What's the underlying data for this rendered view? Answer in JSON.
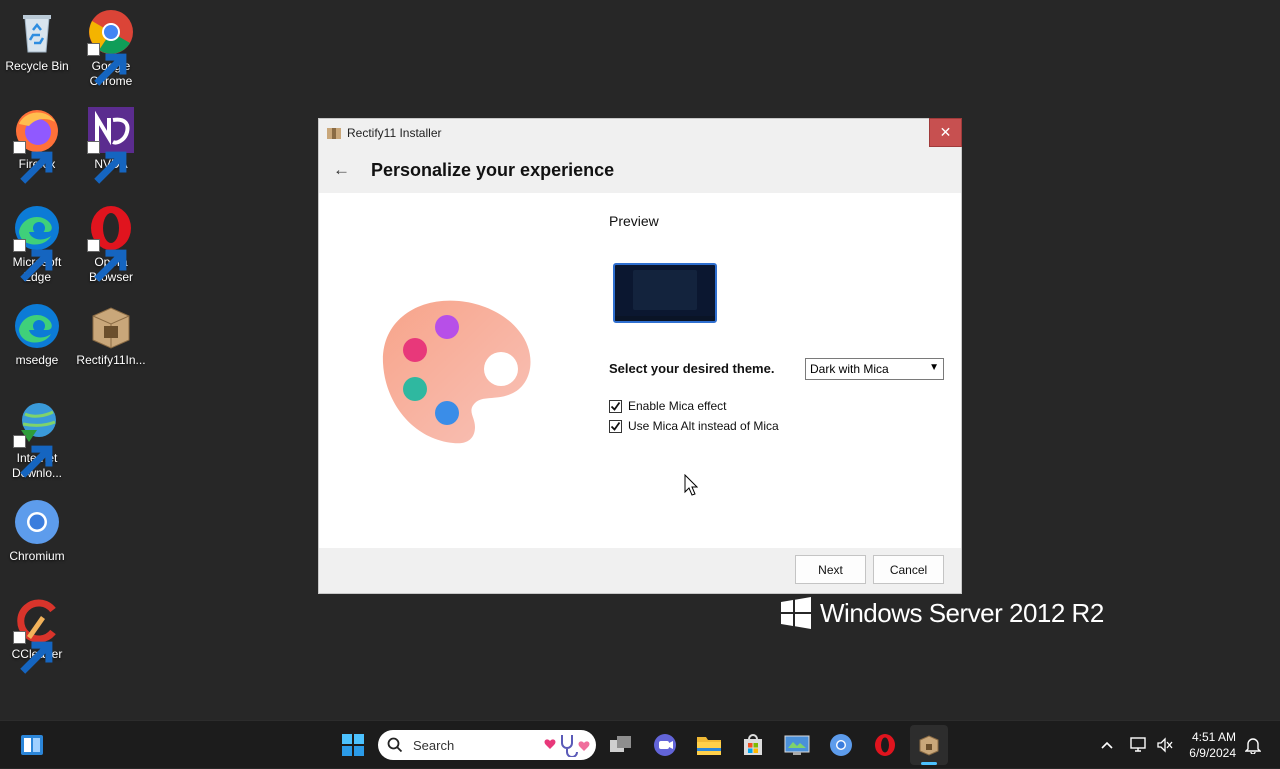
{
  "desktop": {
    "icons": [
      {
        "label": "Recycle Bin"
      },
      {
        "label": "Google Chrome"
      },
      {
        "label": "Firefox"
      },
      {
        "label": "NVDA"
      },
      {
        "label": "Microsoft Edge"
      },
      {
        "label": "Opera Browser"
      },
      {
        "label": "msedge"
      },
      {
        "label": "Rectify11In..."
      },
      {
        "label": "Internet Downlo..."
      },
      {
        "label": "Chromium"
      },
      {
        "label": "CCleaner"
      }
    ],
    "watermark": "Windows Server 2012 R2"
  },
  "window": {
    "title": "Rectify11 Installer",
    "close_label": "✕",
    "header_title": "Personalize your experience",
    "preview_label": "Preview",
    "theme_label": "Select your desired theme.",
    "theme_value": "Dark with Mica",
    "options": [
      {
        "label": "Enable Mica effect",
        "checked": true
      },
      {
        "label": "Use Mica Alt instead of Mica",
        "checked": true
      }
    ],
    "next_label": "Next",
    "cancel_label": "Cancel"
  },
  "taskbar": {
    "search_placeholder": "Search",
    "time": "4:51 AM",
    "date": "6/9/2024"
  },
  "colors": {
    "accent": "#4cc2ff",
    "close": "#c75050",
    "desktop": "#272727"
  }
}
